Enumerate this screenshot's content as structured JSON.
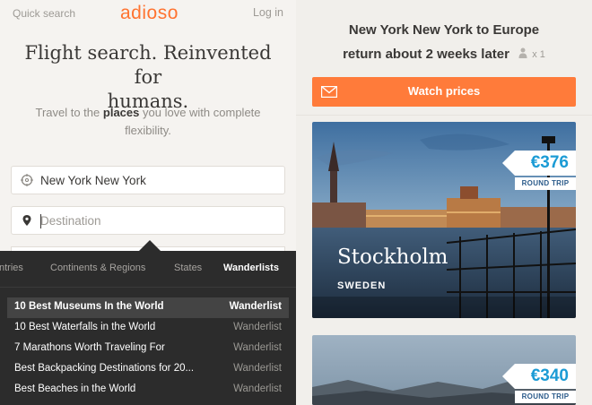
{
  "header": {
    "quick_search": "Quick search",
    "logo": "adioso",
    "login": "Log in"
  },
  "hero": {
    "title_line1": "Flight search. Reinvented for",
    "title_line2": "humans.",
    "sub_pre": "Travel to the",
    "sub_bold": "places",
    "sub_post": "you love with complete flexibility."
  },
  "search": {
    "origin": "New York New York",
    "destination_placeholder": "Destination",
    "destination_value": ""
  },
  "dropdown": {
    "tabs": [
      {
        "label": "ntries",
        "active": false
      },
      {
        "label": "Continents & Regions",
        "active": false
      },
      {
        "label": "States",
        "active": false
      },
      {
        "label": "Wanderlists",
        "active": true
      }
    ],
    "rows": [
      {
        "label": "10 Best Museums In the World",
        "type": "Wanderlist",
        "highlight": true
      },
      {
        "label": "10 Best Waterfalls in the World",
        "type": "Wanderlist",
        "highlight": false
      },
      {
        "label": "7 Marathons Worth Traveling For",
        "type": "Wanderlist",
        "highlight": false
      },
      {
        "label": "Best Backpacking Destinations for 20...",
        "type": "Wanderlist",
        "highlight": false
      },
      {
        "label": "Best Beaches in the World",
        "type": "Wanderlist",
        "highlight": false
      }
    ]
  },
  "results": {
    "heading_line1": "New York New York to Europe",
    "heading_line2": "return about 2 weeks later",
    "passengers": "x 1",
    "watch_label": "Watch prices",
    "cards": [
      {
        "city": "Stockholm",
        "country": "SWEDEN",
        "price": "€376",
        "trip": "ROUND TRIP"
      },
      {
        "city": "",
        "country": "",
        "price": "€340",
        "trip": "ROUND TRIP"
      }
    ]
  },
  "colors": {
    "accent": "#ff7330",
    "price": "#1b9bd5",
    "panel": "#2c2c2c"
  },
  "icons": [
    "envelope-icon",
    "person-icon",
    "crosshair-icon",
    "location-pin-icon"
  ]
}
